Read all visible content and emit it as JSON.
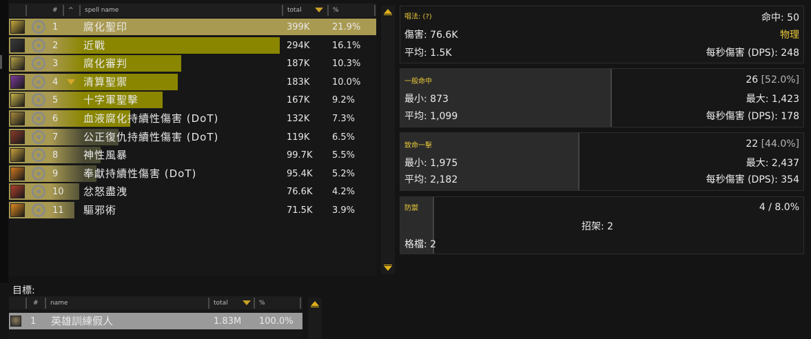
{
  "spell_table": {
    "columns": {
      "rank": "#",
      "sort": "^",
      "name": "spell name",
      "total": "total",
      "pct": "%"
    },
    "rows": [
      {
        "rank": "1",
        "name": "腐化聖印",
        "total": "399K",
        "pct": "21.9%",
        "share": 1.0,
        "icon": "seal-of-corruption-icon",
        "icon_color": "#c7a93a"
      },
      {
        "rank": "2",
        "name": "近戰",
        "total": "294K",
        "pct": "16.1%",
        "share": 0.737,
        "icon": "melee-sword-icon",
        "icon_color": "#3a3a3a"
      },
      {
        "rank": "3",
        "name": "腐化審判",
        "total": "187K",
        "pct": "10.3%",
        "share": 0.469,
        "icon": "judgement-icon",
        "icon_color": "#b9a347"
      },
      {
        "rank": "4",
        "name": "清算聖禦",
        "total": "183K",
        "pct": "10.0%",
        "share": 0.459,
        "icon": "templars-verdict-icon",
        "icon_color": "#7d3a9b",
        "expandable": true
      },
      {
        "rank": "5",
        "name": "十字軍聖擊",
        "total": "167K",
        "pct": "9.2%",
        "share": 0.419,
        "icon": "crusader-strike-icon",
        "icon_color": "#c9b347"
      },
      {
        "rank": "6",
        "name": "血液腐化持續性傷害 (DoT)",
        "total": "132K",
        "pct": "7.3%",
        "share": 0.331,
        "icon": "blood-corruption-icon",
        "icon_color": "#a78a3a"
      },
      {
        "rank": "7",
        "name": "公正復仇持續性傷害 (DoT)",
        "total": "119K",
        "pct": "6.5%",
        "share": 0.298,
        "icon": "censure-icon",
        "icon_color": "#8a3a2a"
      },
      {
        "rank": "8",
        "name": "神性風暴",
        "total": "99.7K",
        "pct": "5.5%",
        "share": 0.25,
        "icon": "divine-storm-icon",
        "icon_color": "#c9a23a"
      },
      {
        "rank": "9",
        "name": "奉獻持續性傷害 (DoT)",
        "total": "95.4K",
        "pct": "5.2%",
        "share": 0.239,
        "icon": "consecration-icon",
        "icon_color": "#d17a1f"
      },
      {
        "rank": "10",
        "name": "忿怒盡洩",
        "total": "76.6K",
        "pct": "4.2%",
        "share": 0.192,
        "icon": "hammer-of-wrath-icon",
        "icon_color": "#b0402a"
      },
      {
        "rank": "11",
        "name": "驅邪術",
        "total": "71.5K",
        "pct": "3.9%",
        "share": 0.179,
        "icon": "exorcism-icon",
        "icon_color": "#e08a1f"
      }
    ]
  },
  "cast_panel": {
    "title": "唱法: (?)",
    "hits": "命中: 50",
    "damage": "傷害: 76.6K",
    "school": "物理",
    "average": "平均: 1.5K",
    "dps": "每秒傷害 (DPS): 248"
  },
  "normal_panel": {
    "title": "一般命中",
    "count": "26",
    "count_pct": "[52.0%]",
    "min": "最小: 873",
    "max": "最大: 1,423",
    "average": "平均: 1,099",
    "dps": "每秒傷害 (DPS): 178",
    "share": 0.52
  },
  "crit_panel": {
    "title": "致命一擊",
    "count": "22",
    "count_pct": "[44.0%]",
    "min": "最小: 1,975",
    "max": "最大: 2,437",
    "average": "平均: 2,182",
    "dps": "每秒傷害 (DPS): 354",
    "share": 0.44
  },
  "defense_panel": {
    "title": "防禦",
    "summary": "4 / 8.0%",
    "parry": "招架: 2",
    "block": "格檔: 2",
    "share": 0.08
  },
  "targets": {
    "label": "目標:",
    "columns": {
      "rank": "#",
      "name": "name",
      "total": "total",
      "pct": "%"
    },
    "rows": [
      {
        "rank": "1",
        "name": "英雄訓練假人",
        "total": "1.83M",
        "pct": "100.0%",
        "share": 1.0,
        "icon": "skull-icon"
      }
    ]
  },
  "colors": {
    "bar_full": "#a99a52",
    "bar_fill": "#8a8600",
    "bar_tail": "#4a4a34",
    "accent_gold": "#e9c83a",
    "target_bar": "#9a9a9a"
  }
}
